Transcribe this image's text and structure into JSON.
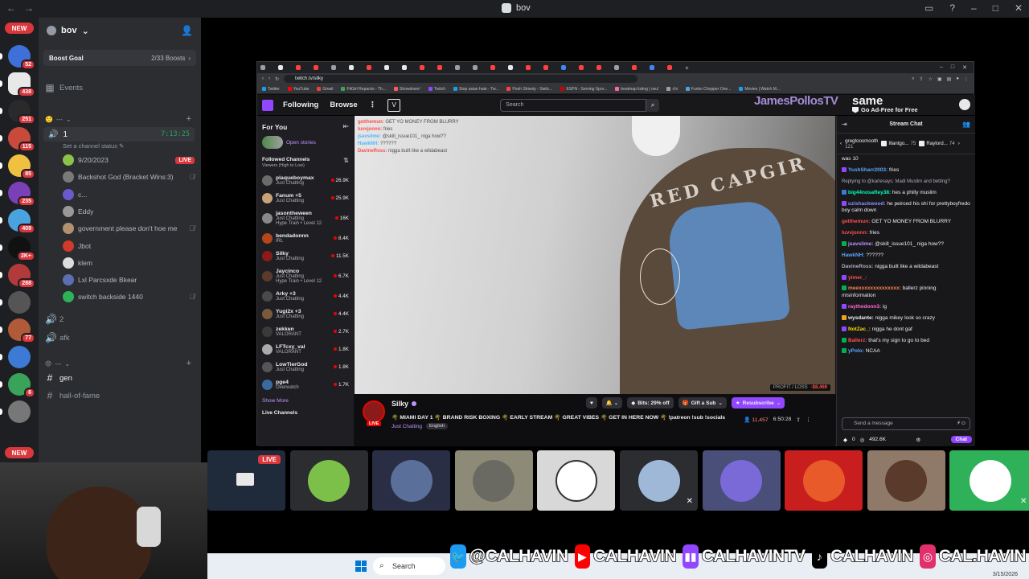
{
  "window": {
    "title": "bov",
    "nav_back": "←",
    "nav_fwd": "→"
  },
  "rail": {
    "new_label": "NEW",
    "servers": [
      {
        "count": "52",
        "color": "#3f6fd8"
      },
      {
        "count": "438",
        "color": "#e8e8e8"
      },
      {
        "count": "251",
        "color": "#2a2a2a"
      },
      {
        "count": "115",
        "color": "#c94a3b"
      },
      {
        "count": "85",
        "color": "#f0c040"
      },
      {
        "count": "235",
        "color": "#7b3fb8"
      },
      {
        "count": "409",
        "color": "#4aa3df"
      },
      {
        "count": "2K+",
        "color": "#111111"
      },
      {
        "count": "288",
        "color": "#b33a3a"
      },
      {
        "count": "",
        "color": "#555555"
      },
      {
        "count": "77",
        "color": "#b05a3a"
      },
      {
        "count": "",
        "color": "#3c7ad6"
      },
      {
        "count": "6",
        "color": "#3aa35a"
      },
      {
        "count": "",
        "color": "#777777"
      }
    ]
  },
  "sidebar": {
    "guild_name": "bov",
    "boost_goal": "Boost Goal",
    "boost_count": "2/33 Boosts",
    "events": "Events",
    "category1": "---",
    "voice_channel": "1",
    "voice_timer": "7:13:25",
    "set_status": "Set a channel status",
    "members": [
      {
        "name": "9/20/2023",
        "live": "LIVE",
        "color": "#8bc34a"
      },
      {
        "name": "Backshot God (Bracket Wins:3)",
        "muted": true,
        "color": "#7a7a7a"
      },
      {
        "name": "c...",
        "color": "#6a5acd"
      },
      {
        "name": "Eddy",
        "color": "#999999"
      },
      {
        "name": "government please don't hoe me",
        "muted": true,
        "color": "#b39070"
      },
      {
        "name": "Jbot",
        "color": "#d03a2a"
      },
      {
        "name": "klem",
        "color": "#dddddd"
      },
      {
        "name": "Lxl Parcsxde Bkear",
        "color": "#5b6fb0"
      },
      {
        "name": "switch backside 1440",
        "muted": true,
        "color": "#2fb15a"
      }
    ],
    "voice2": "2",
    "voice3": "afk",
    "category2": "---",
    "text_channels": [
      "gen",
      "hall-of-fame"
    ]
  },
  "browser": {
    "url": "twitch.tv/silky",
    "bookmarks": [
      "Twitter",
      "YouTube",
      "Gmail",
      "FitGirl Repacks - Th...",
      "Showdown!",
      "Twitch",
      "Stop asian hate - Tw...",
      "Pooh Shiesty - Switc...",
      "ESPN - Serving Spor...",
      "beatmap listing | osu!",
      "chi",
      "Funko Chopper One...",
      "Movies | Watch M..."
    ]
  },
  "twitch": {
    "nav": {
      "following": "Following",
      "browse": "Browse",
      "search_placeholder": "Search"
    },
    "overlay_name": "JamesPollosTV",
    "overlay_name2": "same",
    "ad_free": "Go Ad-Free for Free",
    "left": {
      "for_you": "For You",
      "open_stories": "Open stories",
      "followed": "Followed Channels",
      "sort": "Viewers (High to Low)",
      "channels": [
        {
          "name": "plaqueboymax",
          "category": "Just Chatting",
          "viewers": "26.9K",
          "color": "#6b6b6b"
        },
        {
          "name": "Fanum +5",
          "category": "Just Chatting",
          "viewers": "25.9K",
          "color": "#c9a27a"
        },
        {
          "name": "jasontheween",
          "category": "Just Chatting",
          "extra": "Hype Train • Level 12",
          "viewers": "16K",
          "color": "#888888"
        },
        {
          "name": "bendadonnn",
          "category": "IRL",
          "viewers": "8.4K",
          "color": "#b5451b"
        },
        {
          "name": "Silky",
          "category": "Just Chatting",
          "viewers": "11.5K",
          "color": "#8b1a1a"
        },
        {
          "name": "Jaycinco",
          "category": "Just Chatting",
          "extra": "Hype Train • Level 12",
          "viewers": "6.7K",
          "color": "#5a3b2b"
        },
        {
          "name": "Arky +3",
          "category": "Just Chatting",
          "viewers": "4.4K",
          "color": "#4a4a4a"
        },
        {
          "name": "Yugi2x +3",
          "category": "Just Chatting",
          "viewers": "4.4K",
          "color": "#7a5a3a"
        },
        {
          "name": "zekken",
          "category": "VALORANT",
          "viewers": "2.7K",
          "color": "#3a3a3a"
        },
        {
          "name": "LFTcxy_val",
          "category": "VALORANT",
          "viewers": "1.8K",
          "color": "#aaaaaa"
        },
        {
          "name": "LowTierGod",
          "category": "Just Chatting",
          "viewers": "1.8K",
          "color": "#555555"
        },
        {
          "name": "pge4",
          "category": "Overwatch",
          "viewers": "1.7K",
          "color": "#3a6aa0"
        }
      ],
      "show_more": "Show More",
      "live_channels": "Live Channels"
    },
    "overlay_chat": [
      {
        "user": "getthemun:",
        "text": "GET YO MONEY FROM BLURRY",
        "c": "u"
      },
      {
        "user": "luvvjonnn:",
        "text": "fries",
        "c": "u"
      },
      {
        "user": "jsavslime:",
        "text": "@skill_issue101_ niga how??",
        "c": "u2"
      },
      {
        "user": "HawkNH:",
        "text": "??????",
        "c": "u2"
      },
      {
        "user": "DavineRoss:",
        "text": "nigga built like a wildabeast",
        "c": "u"
      }
    ],
    "profit_loss": "PROFIT / LOSS",
    "profit_value": "-$8,469",
    "stream": {
      "name": "Silky",
      "live": "LIVE",
      "title": "🌴 MIAMI DAY 1 🌴 BRAND RISK BOXING 🌴 EARLY STREAM 🌴 GREAT VIBES 🌴 GET IN HERE NOW 🌴 !patreon !sub !socials",
      "category": "Just Chatting",
      "tag": "English",
      "bits": "Bits: 29% off",
      "gift": "Gift a Sub",
      "resub": "Resubscribe",
      "viewers": "11,457",
      "uptime": "6:50:28"
    },
    "chat": {
      "title": "Stream Chat",
      "gifters": [
        {
          "name": "gregtoosmooth",
          "count": "121"
        },
        {
          "name": "Illantgo...",
          "count": "75"
        },
        {
          "name": "Raylord...",
          "count": "74"
        }
      ],
      "messages": [
        {
          "user": "",
          "text": "was 10",
          "color": "#efeff1"
        },
        {
          "user": "YushSharr2003:",
          "text": "fries",
          "color": "#5aa7ff",
          "badge": "#9147ff"
        },
        {
          "reply": "Replying to @karlesays: Madi Muslim and betting?"
        },
        {
          "user": "big44nosaftey38:",
          "text": "hes a philly muslim",
          "color": "#00ffb0",
          "badge": "#3a7ad6"
        },
        {
          "user": "uzishackwood:",
          "text": "he peirced his shi for prettyboyfredo boy calm down",
          "color": "#8c8cff",
          "badge": "#9147ff"
        },
        {
          "user": "getthemun:",
          "text": "GET YO MONEY FROM BLURRY",
          "color": "#ff4d4d"
        },
        {
          "user": "luvvjonnn:",
          "text": "fries",
          "color": "#ff4d4d"
        },
        {
          "user": "jsavslime:",
          "text": "@skill_issue101_ niga how??",
          "color": "#bf94ff",
          "badge": "#00b050"
        },
        {
          "user": "HawkNH:",
          "text": "??????",
          "color": "#5aa7ff"
        },
        {
          "user": "DavineRoss:",
          "text": "nigga built like a wildabeast",
          "color": "#adadb8"
        },
        {
          "user": "yimer_:",
          "text": "",
          "color": "#ff4d4d",
          "badge": "#9147ff"
        },
        {
          "user": "meexxxxxxxxxxxxxx:",
          "text": "ballerz pinning misinformation",
          "color": "#ff7f50",
          "badge": "#00b050"
        },
        {
          "user": "raythedonn3:",
          "text": "ig",
          "color": "#ff6ad5",
          "badge": "#9147ff"
        },
        {
          "user": "wysdante:",
          "text": "nigga mikey look so crazy",
          "color": "#efeff1",
          "badge": "#f0a020"
        },
        {
          "user": "NotZac_:",
          "text": "nigga he dont gaf",
          "color": "#ffd700",
          "badge": "#9147ff"
        },
        {
          "user": "Ballerz:",
          "text": "that's my sign to go to bed",
          "color": "#ff4d4d",
          "badge": "#00b050"
        },
        {
          "user": "yPolo:",
          "text": "NCAA",
          "color": "#5aa7ff",
          "badge": "#00b050"
        }
      ],
      "placeholder": "Send a message",
      "points": "492.6K",
      "zero": "0",
      "chat_button": "Chat"
    }
  },
  "tiles": [
    {
      "color": "#1f2a3a",
      "live": "LIVE"
    },
    {
      "color": "#2b2d31",
      "face": "#7cc04a"
    },
    {
      "color": "#2a2e44",
      "face": "#5a6f9a"
    },
    {
      "color": "#8d8a78",
      "face": "#6b6a62"
    },
    {
      "color": "#d8d8d8",
      "face": "#ffffff"
    },
    {
      "color": "#2b2d31",
      "face": "#9fb8d8",
      "muted": true
    },
    {
      "color": "#4a4f7a",
      "face": "#7a6ad8"
    },
    {
      "color": "#c81e1e",
      "face": "#e85a2a"
    },
    {
      "color": "#8f7a6a",
      "face": "#5a3a2a"
    },
    {
      "color": "#2fb15a",
      "face": "#ffffff",
      "muted": true
    }
  ],
  "taskbar": {
    "search": "Search",
    "date": "3/15/2026"
  },
  "social": {
    "twitter": "@CALHAVIN",
    "youtube": "CALHAVIN",
    "twitch": "CALHAVINTV",
    "tiktok": "CALHAVIN",
    "instagram": "CAL.HAVIN"
  }
}
